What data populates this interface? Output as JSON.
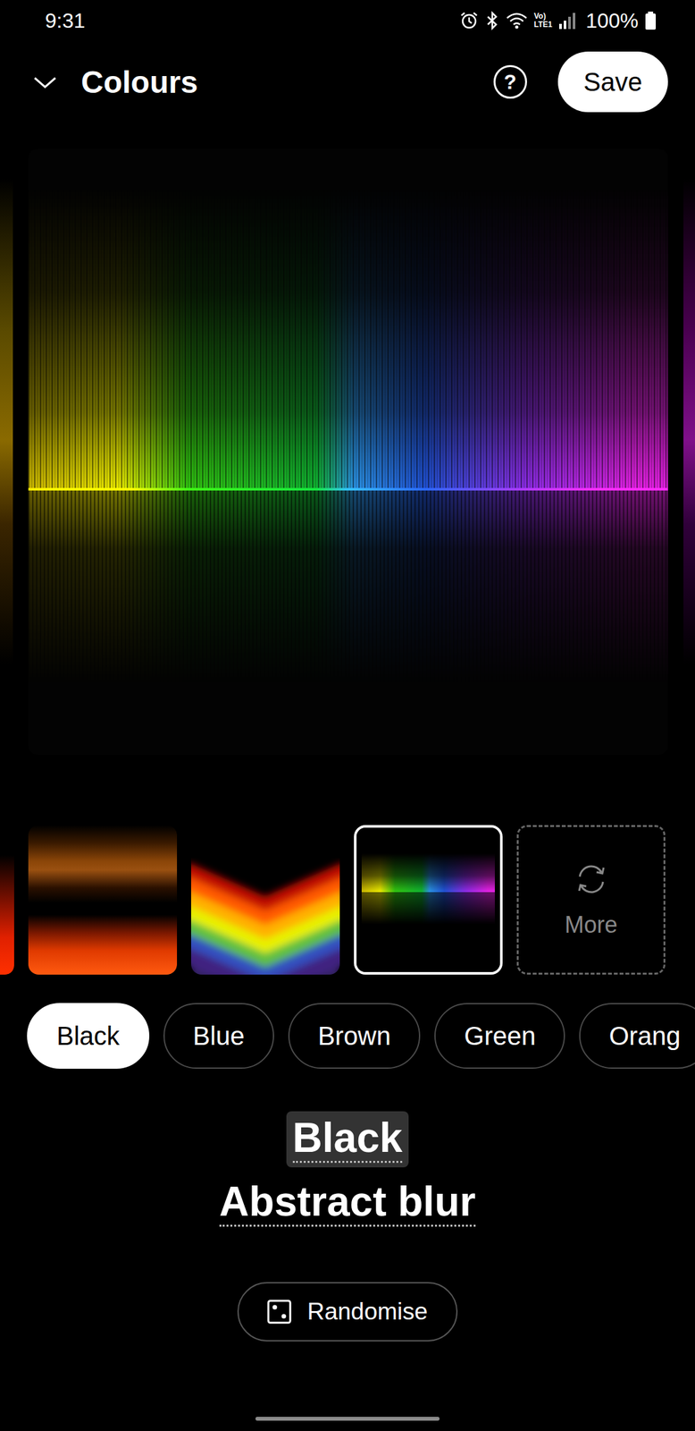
{
  "status_bar": {
    "time": "9:31",
    "network": [
      "Vo)",
      "LTE1"
    ],
    "battery": "100%"
  },
  "header": {
    "title": "Colours",
    "help": "?",
    "save": "Save"
  },
  "thumbnails": [
    {
      "kind": "red-glow",
      "selected": false
    },
    {
      "kind": "bands",
      "selected": false
    },
    {
      "kind": "chevron",
      "selected": false
    },
    {
      "kind": "spectrum",
      "selected": true
    }
  ],
  "more": {
    "label": "More"
  },
  "chips": [
    {
      "label": "Black",
      "selected": true
    },
    {
      "label": "Blue",
      "selected": false
    },
    {
      "label": "Brown",
      "selected": false
    },
    {
      "label": "Green",
      "selected": false
    },
    {
      "label": "Orang",
      "selected": false
    }
  ],
  "selection": {
    "colour": "Black",
    "style": "Abstract blur"
  },
  "randomise": {
    "label": "Randomise"
  }
}
